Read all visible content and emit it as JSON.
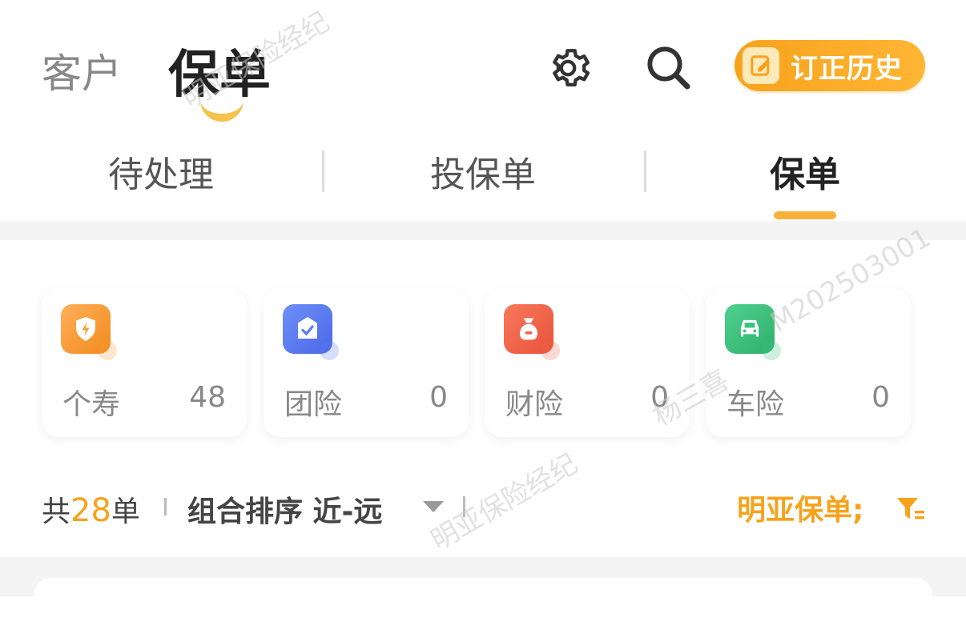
{
  "header": {
    "nav_inactive": "客户",
    "nav_active": "保单",
    "history_label": "订正历史"
  },
  "tabs": [
    {
      "label": "待处理",
      "active": false
    },
    {
      "label": "投保单",
      "active": false
    },
    {
      "label": "保单",
      "active": true
    }
  ],
  "categories": [
    {
      "label": "个寿",
      "count": "48",
      "icon": "shield-lightning-icon",
      "color": "#f7a035"
    },
    {
      "label": "团险",
      "count": "0",
      "icon": "group-shield-check-icon",
      "color": "#5a7cf2"
    },
    {
      "label": "财险",
      "count": "0",
      "icon": "money-bag-icon",
      "color": "#f0644a"
    },
    {
      "label": "车险",
      "count": "0",
      "icon": "car-icon",
      "color": "#3cc27f"
    }
  ],
  "toolbar": {
    "total_prefix": "共",
    "total_count": "28",
    "total_suffix": "单",
    "sort_label": "组合排序 近-远",
    "filter_label": "明亚保单;"
  },
  "watermark": {
    "company": "明亚保险经纪",
    "name": "杨三喜",
    "id": "M202503001"
  },
  "colors": {
    "accent": "#f7a21b",
    "tab_underline": "#f7b23b"
  }
}
